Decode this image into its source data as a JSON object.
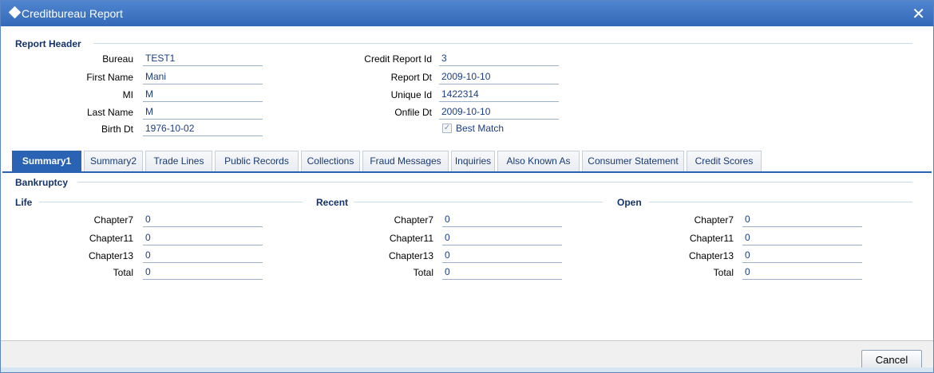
{
  "window": {
    "title": "Creditbureau Report",
    "close_glyph": "✕"
  },
  "header": {
    "section_title": "Report Header",
    "left": [
      {
        "label": "Bureau",
        "value": "TEST1"
      },
      {
        "label": "First Name",
        "value": "Mani"
      },
      {
        "label": "MI",
        "value": "M"
      },
      {
        "label": "Last Name",
        "value": "M"
      },
      {
        "label": "Birth Dt",
        "value": "1976-10-02"
      }
    ],
    "right": [
      {
        "label": "Credit Report Id",
        "value": "3"
      },
      {
        "label": "Report Dt",
        "value": "2009-10-10"
      },
      {
        "label": "Unique Id",
        "value": "1422314"
      },
      {
        "label": "Onfile Dt",
        "value": "2009-10-10"
      }
    ],
    "best_match": {
      "label": "Best Match",
      "checked": true,
      "check_glyph": "✓"
    }
  },
  "tabs": [
    "Summary1",
    "Summary2",
    "Trade Lines",
    "Public Records",
    "Collections",
    "Fraud Messages",
    "Inquiries",
    "Also Known As",
    "Consumer Statement",
    "Credit Scores"
  ],
  "active_tab": "Summary1",
  "bankruptcy": {
    "title": "Bankruptcy",
    "groups": [
      {
        "title": "Life",
        "rows": [
          {
            "label": "Chapter7",
            "value": "0"
          },
          {
            "label": "Chapter11",
            "value": "0"
          },
          {
            "label": "Chapter13",
            "value": "0"
          },
          {
            "label": "Total",
            "value": "0"
          }
        ]
      },
      {
        "title": "Recent",
        "rows": [
          {
            "label": "Chapter7",
            "value": "0"
          },
          {
            "label": "Chapter11",
            "value": "0"
          },
          {
            "label": "Chapter13",
            "value": "0"
          },
          {
            "label": "Total",
            "value": "0"
          }
        ]
      },
      {
        "title": "Open",
        "rows": [
          {
            "label": "Chapter7",
            "value": "0"
          },
          {
            "label": "Chapter11",
            "value": "0"
          },
          {
            "label": "Chapter13",
            "value": "0"
          },
          {
            "label": "Total",
            "value": "0"
          }
        ]
      }
    ]
  },
  "footer": {
    "cancel_label": "Cancel"
  }
}
